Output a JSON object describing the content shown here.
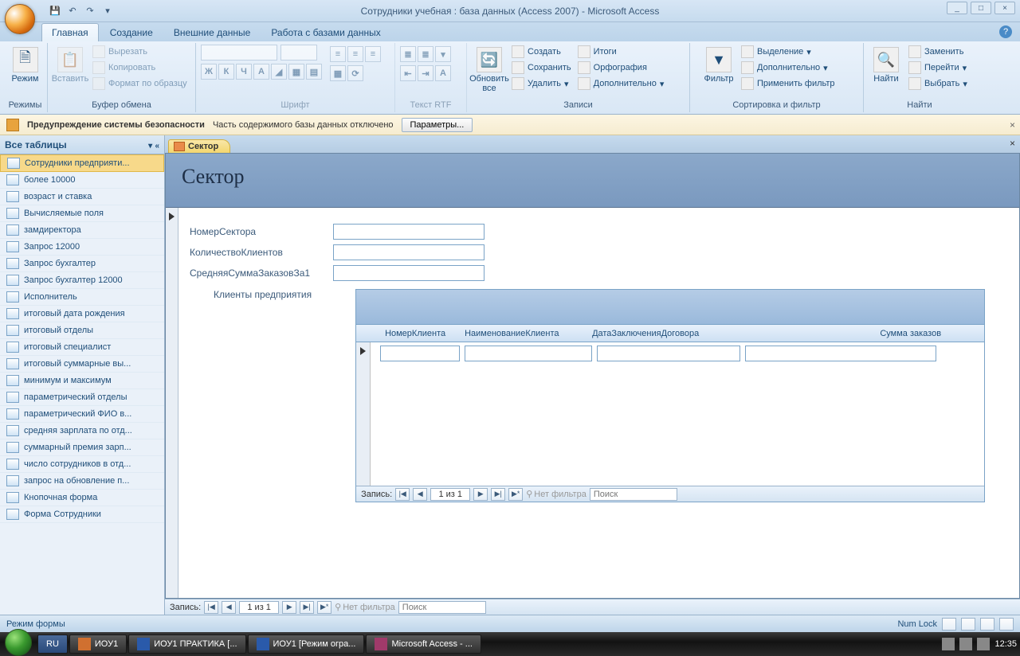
{
  "title": "Сотрудники учебная : база данных (Access 2007) - Microsoft Access",
  "tabs": {
    "main": "Главная",
    "create": "Создание",
    "external": "Внешние данные",
    "dbtools": "Работа с базами данных"
  },
  "ribbon": {
    "modes": {
      "btn": "Режим",
      "label": "Режимы"
    },
    "clipboard": {
      "paste": "Вставить",
      "cut": "Вырезать",
      "copy": "Копировать",
      "format": "Формат по образцу",
      "label": "Буфер обмена"
    },
    "font": {
      "label": "Шрифт",
      "b": "Ж",
      "i": "К",
      "u": "Ч"
    },
    "rtf": {
      "label": "Текст RTF"
    },
    "refresh": {
      "btn": "Обновить все",
      "label": "Записи",
      "new": "Создать",
      "save": "Сохранить",
      "delete": "Удалить",
      "totals": "Итоги",
      "spelling": "Орфография",
      "more": "Дополнительно"
    },
    "sort": {
      "filter": "Фильтр",
      "selection": "Выделение",
      "advanced": "Дополнительно",
      "toggle": "Применить фильтр",
      "label": "Сортировка и фильтр"
    },
    "find": {
      "find": "Найти",
      "replace": "Заменить",
      "goto": "Перейти",
      "select": "Выбрать",
      "label": "Найти"
    }
  },
  "security": {
    "title": "Предупреждение системы безопасности",
    "msg": "Часть содержимого базы данных отключено",
    "btn": "Параметры..."
  },
  "nav": {
    "header": "Все таблицы",
    "items": [
      "Сотрудники предприяти...",
      "более 10000",
      "возраст и ставка",
      "Вычисляемые поля",
      "замдиректора",
      "Запрос 12000",
      "Запрос бухгалтер",
      "Запрос бухгалтер 12000",
      "Исполнитель",
      "итоговый дата рождения",
      "итоговый отделы",
      "итоговый специалист",
      "итоговый суммарные вы...",
      "минимум и максимум",
      "параметрический отделы",
      "параметрический ФИО в...",
      "средняя зарплата по отд...",
      "суммарный премия зарп...",
      "число сотрудников в отд...",
      "запрос на обновление п...",
      "Кнопочная форма",
      "Форма Сотрудники"
    ]
  },
  "doctab": "Сектор",
  "form": {
    "title": "Сектор",
    "fields": {
      "f1": "НомерСектора",
      "f2": "КоличествоКлиентов",
      "f3": "СредняяСуммаЗаказовЗа1"
    },
    "subform_label": "Клиенты предприятия",
    "cols": {
      "c1": "НомерКлиента",
      "c2": "НаименованиеКлиента",
      "c3": "ДатаЗаключенияДоговора",
      "c4": "Сумма заказов"
    }
  },
  "recnav": {
    "label": "Запись:",
    "pos": "1 из 1",
    "nofilter": "Нет фильтра",
    "search": "Поиск"
  },
  "status": {
    "mode": "Режим формы",
    "numlock": "Num Lock"
  },
  "taskbar": {
    "lang": "RU",
    "b1": "ИОУ1",
    "b2": "ИОУ1 ПРАКТИКА [...",
    "b3": "ИОУ1 [Режим огра...",
    "b4": "Microsoft Access - ...",
    "time": "12:35"
  }
}
